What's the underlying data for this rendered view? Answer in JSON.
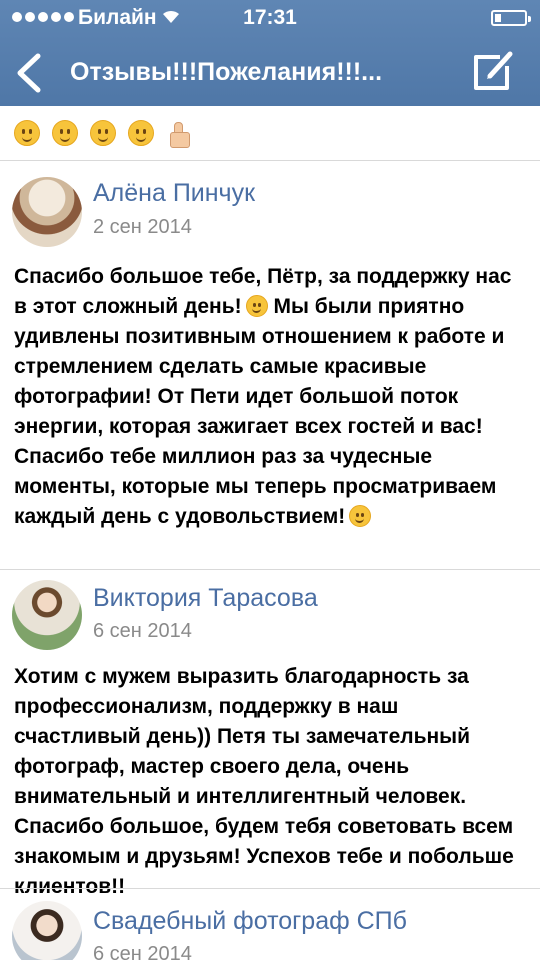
{
  "status_bar": {
    "carrier": "Билайн",
    "time": "17:31"
  },
  "nav": {
    "title": "Отзывы!!!Пожелания!!!...",
    "back_icon": "chevron-left-icon",
    "compose_icon": "compose-icon"
  },
  "emoji_row": [
    "winking-face-icon",
    "grinning-face-icon",
    "yum-face-icon",
    "smiling-face-icon",
    "thumbs-up-icon"
  ],
  "posts": [
    {
      "author": "Алёна Пинчук",
      "date": "2 сен 2014",
      "text_1": "Спасибо большое тебе, Пётр, за поддержку нас в этот сложный день!",
      "text_2": "Мы были приятно удивлены позитивным отношением к работе и стремлением сделать самые красивые фотографии! От Пети идет большой поток энергии, которая зажигает всех гостей и вас! Спасибо тебе миллион раз за чудесные моменты, которые мы теперь просматриваем каждый день с удовольствием!"
    },
    {
      "author": "Виктория Тарасова",
      "date": "6 сен 2014",
      "text": "Хотим с мужем выразить благодарность за профессионализм, поддержку в наш счастливый день)) Петя ты замечательный фотограф, мастер своего дела, очень внимательный и интеллигентный человек. Спасибо большое, будем тебя советовать всем знакомым и друзьям! Успехов тебе и побольше клиентов!!"
    },
    {
      "author": "Свадебный фотограф  СПб",
      "date": "6 сен 2014"
    }
  ],
  "colors": {
    "nav_bar": "#5579a9",
    "author_link": "#4a6ea3",
    "date_gray": "#8a8a8a"
  }
}
